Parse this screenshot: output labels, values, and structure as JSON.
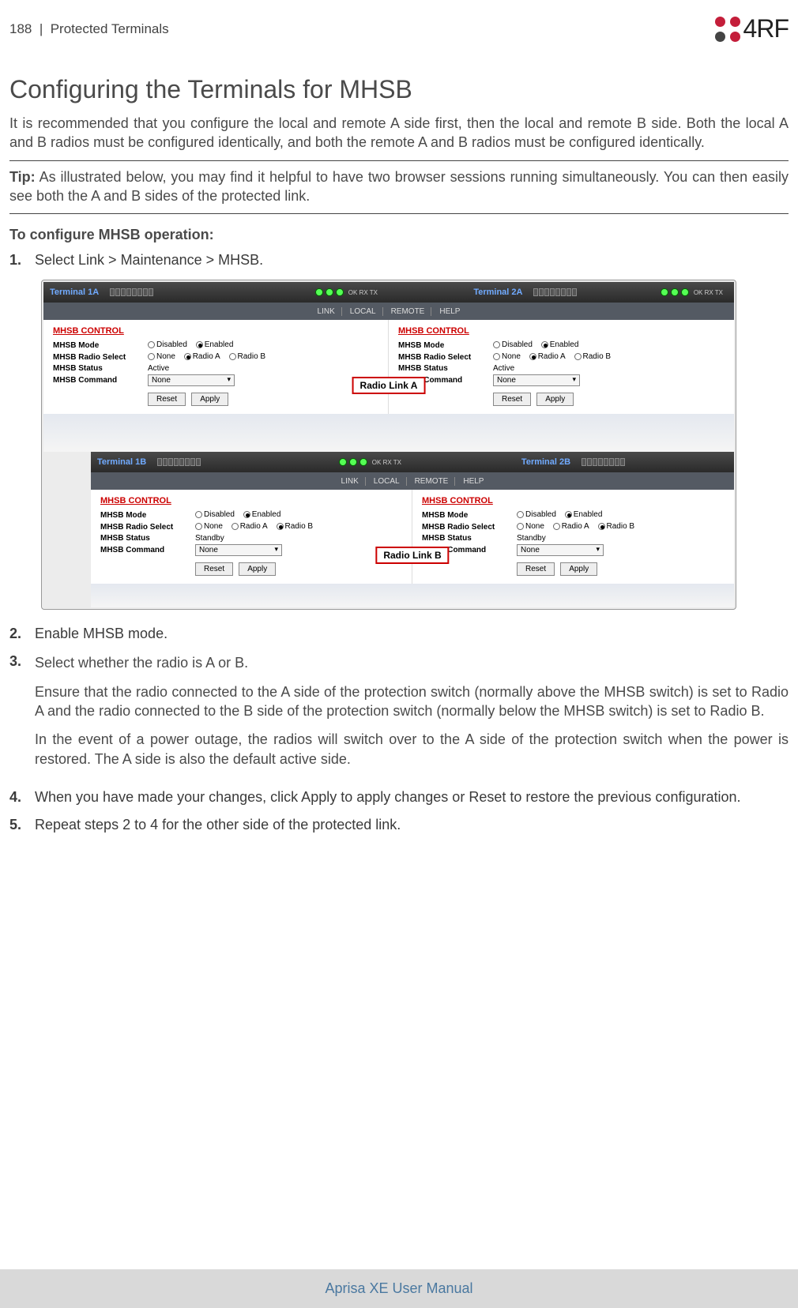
{
  "header": {
    "page_number": "188",
    "separator": "|",
    "section": "Protected Terminals",
    "logo_text": "4RF"
  },
  "title": "Configuring the Terminals for MHSB",
  "intro": "It is recommended that you configure the local and remote A side first, then the local and remote B side. Both the local A and B radios must be configured identically, and both the remote A and B radios must be configured identically.",
  "tip_label": "Tip:",
  "tip_text": "As illustrated below, you may find it helpful to have two browser sessions running simultaneously. You can then easily see both the A and B sides of the protected link.",
  "config_heading": "To configure MHSB operation:",
  "steps": {
    "s1_num": "1.",
    "s1_text": "Select Link > Maintenance > MHSB.",
    "s2_num": "2.",
    "s2_text": "Enable MHSB mode.",
    "s3_num": "3.",
    "s3_text": "Select whether the radio is A or B.",
    "s3_p2": "Ensure that the radio connected to the A side of the protection switch (normally above the MHSB switch) is set to Radio A and the radio connected to the B side of the protection switch (normally below the MHSB switch) is set to Radio B.",
    "s3_p3": "In the event of a power outage, the radios will switch over to the A side of the protection switch when the power is restored. The A side is also the default active side.",
    "s4_num": "4.",
    "s4_text": "When you have made your changes, click Apply to apply changes or Reset to restore the previous configuration.",
    "s5_num": "5.",
    "s5_text": "Repeat steps 2 to 4 for the other side of the protected link."
  },
  "screenshot": {
    "nav": {
      "link": "LINK",
      "local": "LOCAL",
      "remote": "REMOTE",
      "help": "HELP"
    },
    "leds_label": "OK  RX  TX",
    "link_a_label": "Radio Link A",
    "link_b_label": "Radio Link B",
    "terminals": {
      "t1a": "Terminal 1A",
      "t2a": "Terminal 2A",
      "t1b": "Terminal 1B",
      "t2b": "Terminal 2B"
    },
    "panel": {
      "heading": "MHSB CONTROL",
      "mode_label": "MHSB Mode",
      "radio_select_label": "MHSB Radio Select",
      "status_label": "MHSB Status",
      "command_label": "MHSB Command",
      "opt_disabled": "Disabled",
      "opt_enabled": "Enabled",
      "opt_none": "None",
      "opt_radio_a": "Radio A",
      "opt_radio_b": "Radio B",
      "status_active": "Active",
      "status_standby": "Standby",
      "cmd_none": "None",
      "btn_reset": "Reset",
      "btn_apply": "Apply"
    }
  },
  "footer": "Aprisa XE User Manual"
}
